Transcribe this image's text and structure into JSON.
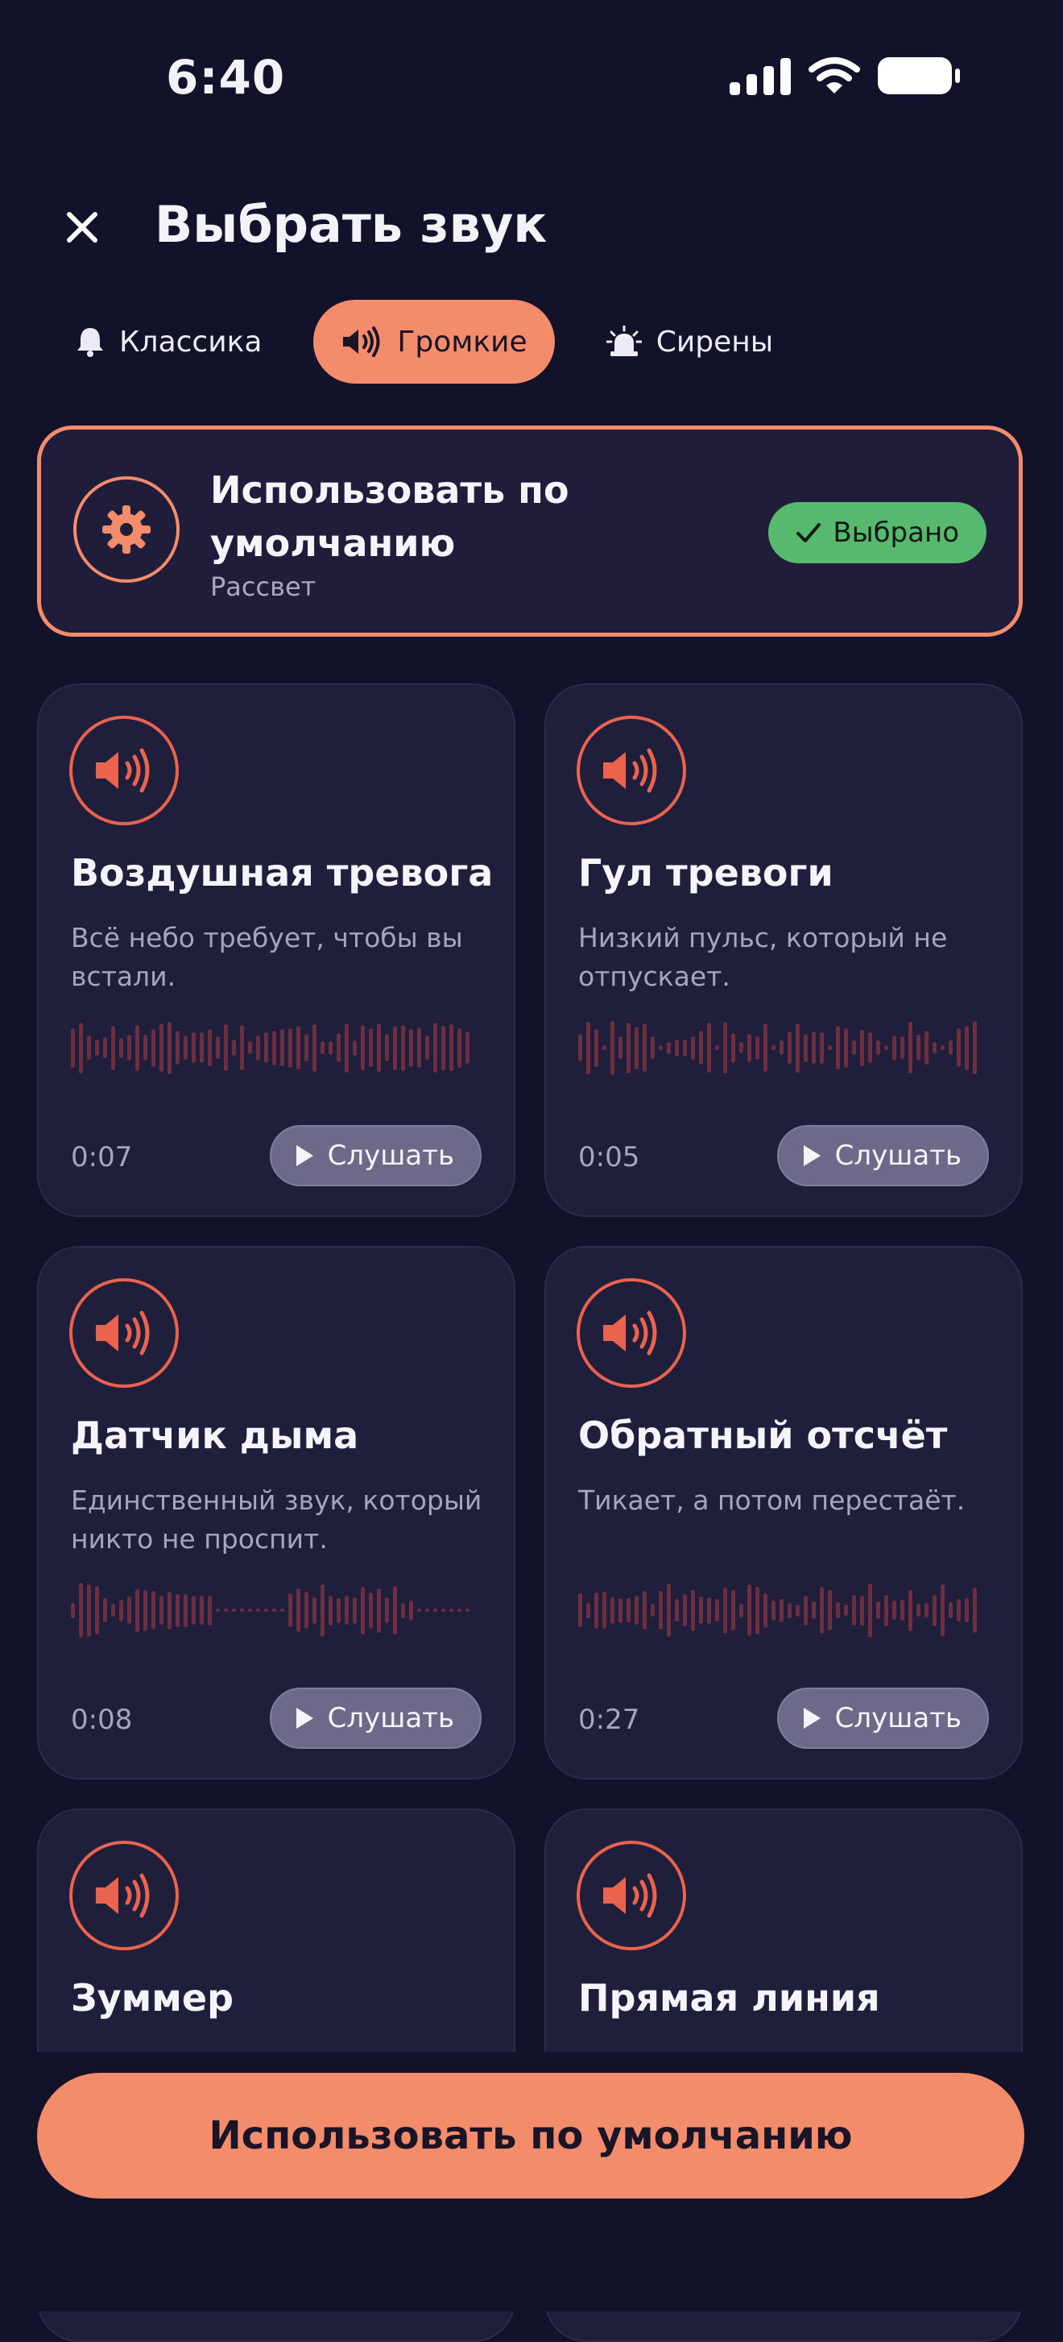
{
  "status": {
    "time": "6:40"
  },
  "header": {
    "title": "Выбрать звук"
  },
  "tabs": [
    {
      "label": "Классика",
      "icon": "bell-icon",
      "active": false
    },
    {
      "label": "Громкие",
      "icon": "speaker-icon",
      "active": true
    },
    {
      "label": "Сирены",
      "icon": "siren-icon",
      "active": false
    }
  ],
  "default_option": {
    "title": "Использовать по умолчанию",
    "subtitle": "Рассвет",
    "badge": "Выбрано",
    "icon": "gear-icon"
  },
  "sounds": [
    {
      "title": "Воздушная тревога",
      "description": "Всё небо требует, чтобы вы встали.",
      "duration": "0:07",
      "action": "Слушать"
    },
    {
      "title": "Гул тревоги",
      "description": "Низкий пульс, который не отпускает.",
      "duration": "0:05",
      "action": "Слушать"
    },
    {
      "title": "Датчик дыма",
      "description": "Единственный звук, который никто не проспит.",
      "duration": "0:08",
      "action": "Слушать"
    },
    {
      "title": "Обратный отсчёт",
      "description": "Тикает, а потом перестаёт.",
      "duration": "0:27",
      "action": "Слушать"
    },
    {
      "title": "Зуммер",
      "description": "",
      "duration": "",
      "action": ""
    },
    {
      "title": "Прямая линия",
      "description": "",
      "duration": "",
      "action": ""
    }
  ],
  "colors": {
    "accent": "#f38c6b",
    "selected": "#56b96e",
    "speaker": "#e9634f",
    "background": "#12122a",
    "card": "#1f1e3b"
  },
  "footer": {
    "button_label": "Использовать по умолчанию"
  }
}
